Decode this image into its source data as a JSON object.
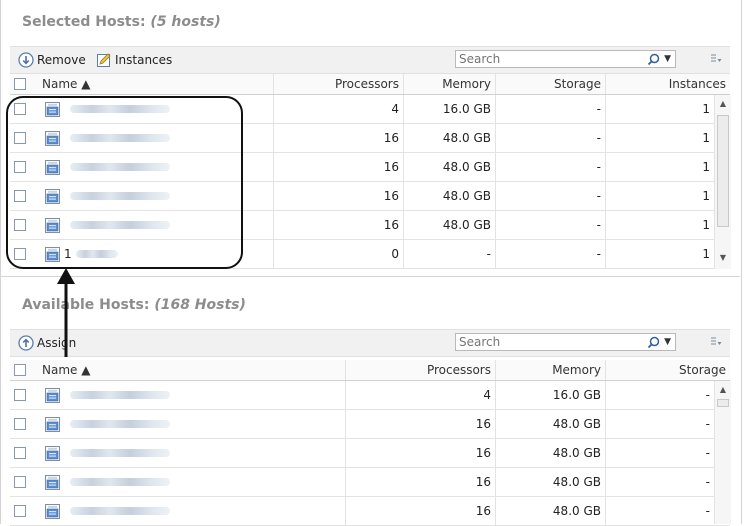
{
  "selected": {
    "title": "Selected Hosts:",
    "count": "(5 hosts)",
    "toolbar": {
      "remove_label": "Remove",
      "instances_label": "Instances"
    },
    "search": {
      "placeholder": "Search"
    },
    "columns": [
      "Name ▲",
      "Processors",
      "Memory",
      "Storage",
      "Instances"
    ],
    "rows": [
      {
        "processors": "4",
        "memory": "16.0 GB",
        "storage": "-",
        "instances": "1"
      },
      {
        "processors": "16",
        "memory": "48.0 GB",
        "storage": "-",
        "instances": "1"
      },
      {
        "processors": "16",
        "memory": "48.0 GB",
        "storage": "-",
        "instances": "1"
      },
      {
        "processors": "16",
        "memory": "48.0 GB",
        "storage": "-",
        "instances": "1"
      },
      {
        "processors": "16",
        "memory": "48.0 GB",
        "storage": "-",
        "instances": "1"
      },
      {
        "name_prefix": "1",
        "processors": "0",
        "memory": "-",
        "storage": "-",
        "instances": "1"
      }
    ]
  },
  "available": {
    "title": "Available Hosts:",
    "count": "(168 Hosts)",
    "toolbar": {
      "assign_label": "Assign"
    },
    "search": {
      "placeholder": "Search"
    },
    "columns": [
      "Name ▲",
      "Processors",
      "Memory",
      "Storage"
    ],
    "rows": [
      {
        "processors": "4",
        "memory": "16.0 GB",
        "storage": "-"
      },
      {
        "processors": "16",
        "memory": "48.0 GB",
        "storage": "-"
      },
      {
        "processors": "16",
        "memory": "48.0 GB",
        "storage": "-"
      },
      {
        "processors": "16",
        "memory": "48.0 GB",
        "storage": "-"
      },
      {
        "processors": "16",
        "memory": "48.0 GB",
        "storage": "-"
      }
    ]
  },
  "icons": {
    "remove": "remove-icon",
    "instances": "edit-pencil-icon",
    "assign": "assign-icon",
    "search": "search-magnifier-icon",
    "dropdown": "chevron-down-icon",
    "options": "column-options-icon",
    "host": "server-host-icon"
  },
  "colors": {
    "section_title": "#8c8c8c",
    "toolbar_bg": "#f1f1f1",
    "annotation": "#111111"
  }
}
